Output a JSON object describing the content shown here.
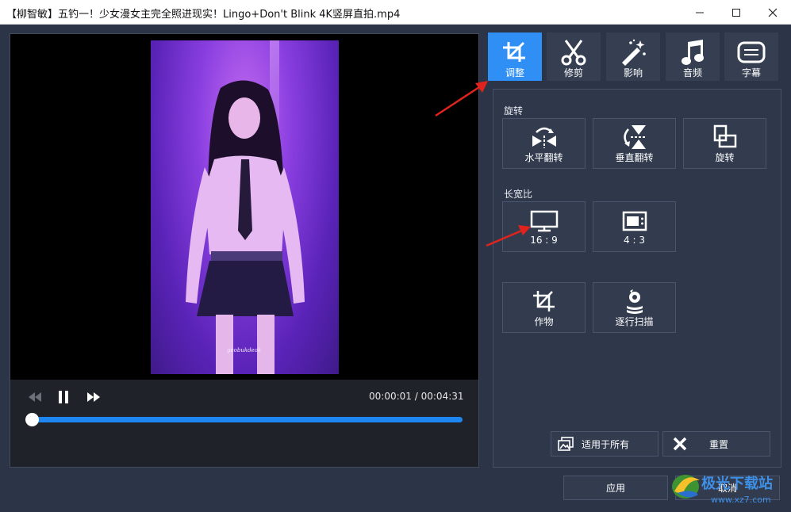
{
  "window": {
    "title": "【柳智敏】五钓一！少女漫女主完全照进现实！Lingo+Don't Blink 4K竖屏直拍.mp4"
  },
  "video": {
    "overlay_text": "geobukdeok",
    "current_time": "00:00:01",
    "separator": "/",
    "total_time": "00:04:31",
    "progress_fraction": 0.0
  },
  "tabs": [
    {
      "label": "调整",
      "icon": "crop-adjust-icon",
      "active": true
    },
    {
      "label": "修剪",
      "icon": "scissors-icon",
      "active": false
    },
    {
      "label": "影响",
      "icon": "magic-wand-icon",
      "active": false
    },
    {
      "label": "音频",
      "icon": "music-note-icon",
      "active": false
    },
    {
      "label": "字幕",
      "icon": "subtitle-icon",
      "active": false
    }
  ],
  "rotate": {
    "title": "旋转",
    "options": [
      {
        "label": "水平翻转",
        "icon": "flip-horizontal-icon"
      },
      {
        "label": "垂直翻转",
        "icon": "flip-vertical-icon"
      },
      {
        "label": "旋转",
        "icon": "rotate-icon"
      }
    ]
  },
  "aspect": {
    "title": "长宽比",
    "options": [
      {
        "label": "16 : 9",
        "icon": "monitor-icon"
      },
      {
        "label": "4 : 3",
        "icon": "tv-icon"
      }
    ]
  },
  "tools": [
    {
      "label": "作物",
      "icon": "crop-icon"
    },
    {
      "label": "逐行扫描",
      "icon": "deinterlace-icon"
    }
  ],
  "actions": {
    "apply_all": "适用于所有",
    "reset": "重置",
    "apply": "应用",
    "cancel": "取消"
  },
  "watermark": {
    "text": "极光下载站",
    "url": "www.xz7.com"
  },
  "colors": {
    "accent": "#2f8ff5",
    "panel": "#2f384b",
    "annotation_arrow": "#e0231c"
  }
}
